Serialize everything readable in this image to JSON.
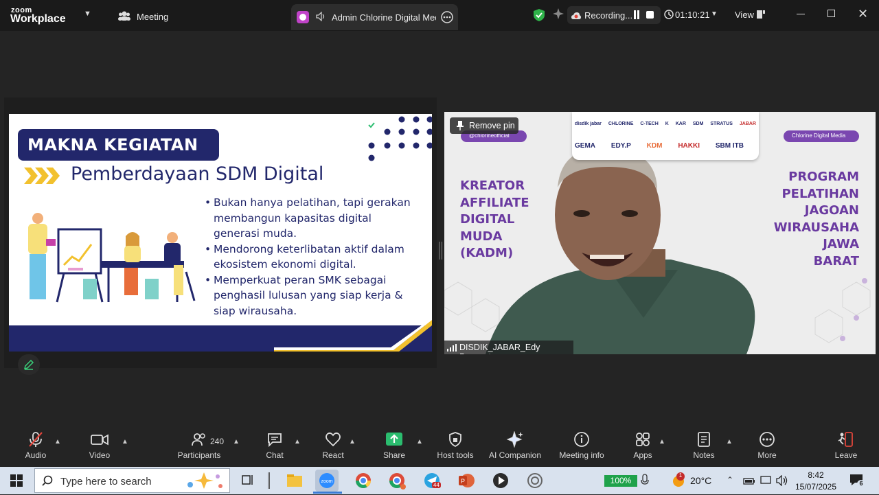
{
  "zoom": {
    "brand_top": "zoom",
    "brand_bottom": "Workplace",
    "meeting_label": "Meeting",
    "tab_title": "Admin Chlorine Digital Media",
    "recording_label": "Recording...",
    "timer": "01:10:21",
    "view_label": "View"
  },
  "slide": {
    "heading": "MAKNA KEGIATAN",
    "subtitle": "Pemberdayaan SDM Digital",
    "bullets": [
      "Bukan hanya pelatihan, tapi gerakan membangun kapasitas digital generasi muda.",
      "Mendorong keterlibatan aktif dalam ekosistem ekonomi digital.",
      "Memperkuat peran SMK sebagai penghasil lulusan yang siap kerja & siap wirausaha."
    ]
  },
  "video": {
    "remove_pin": "Remove pin",
    "left_tag": "@chlorineofficial",
    "right_tag": "Chlorine Digital Media",
    "left_title": [
      "KREATOR",
      "AFFILIATE",
      "DIGITAL",
      "MUDA",
      "(KADM)"
    ],
    "right_title": [
      "PROGRAM",
      "PELATIHAN",
      "JAGOAN",
      "WIRAUSAHA",
      "JAWA",
      "BARAT"
    ],
    "logos_row1": [
      "disdik jabar",
      "CHLORINE",
      "C-TECH",
      "K",
      "KAR",
      "SDM",
      "STRATUS",
      "JABAR"
    ],
    "logos_row2": [
      "GEMA",
      "EDY.P",
      "KDM",
      "HAKKI",
      "SBM ITB"
    ],
    "participant_name": "DISDIK_JABAR_Edy Purwanto"
  },
  "toolbar": {
    "audio": "Audio",
    "video": "Video",
    "participants": "Participants",
    "participants_count": "240",
    "chat": "Chat",
    "react": "React",
    "share": "Share",
    "host_tools": "Host tools",
    "ai_companion": "AI Companion",
    "meeting_info": "Meeting info",
    "apps": "Apps",
    "notes": "Notes",
    "more": "More",
    "leave": "Leave"
  },
  "taskbar": {
    "search_placeholder": "Type here to search",
    "telegram_badge": "44",
    "battery": "100%",
    "weather_badge": "1",
    "temperature": "20°C",
    "time": "8:42",
    "date": "15/07/2025",
    "notifications": "6"
  },
  "colors": {
    "slide_navy": "#22276b",
    "slide_yellow": "#f2c12e",
    "banner_purple": "#6a3aa0",
    "share_green": "#2bbd6f"
  }
}
